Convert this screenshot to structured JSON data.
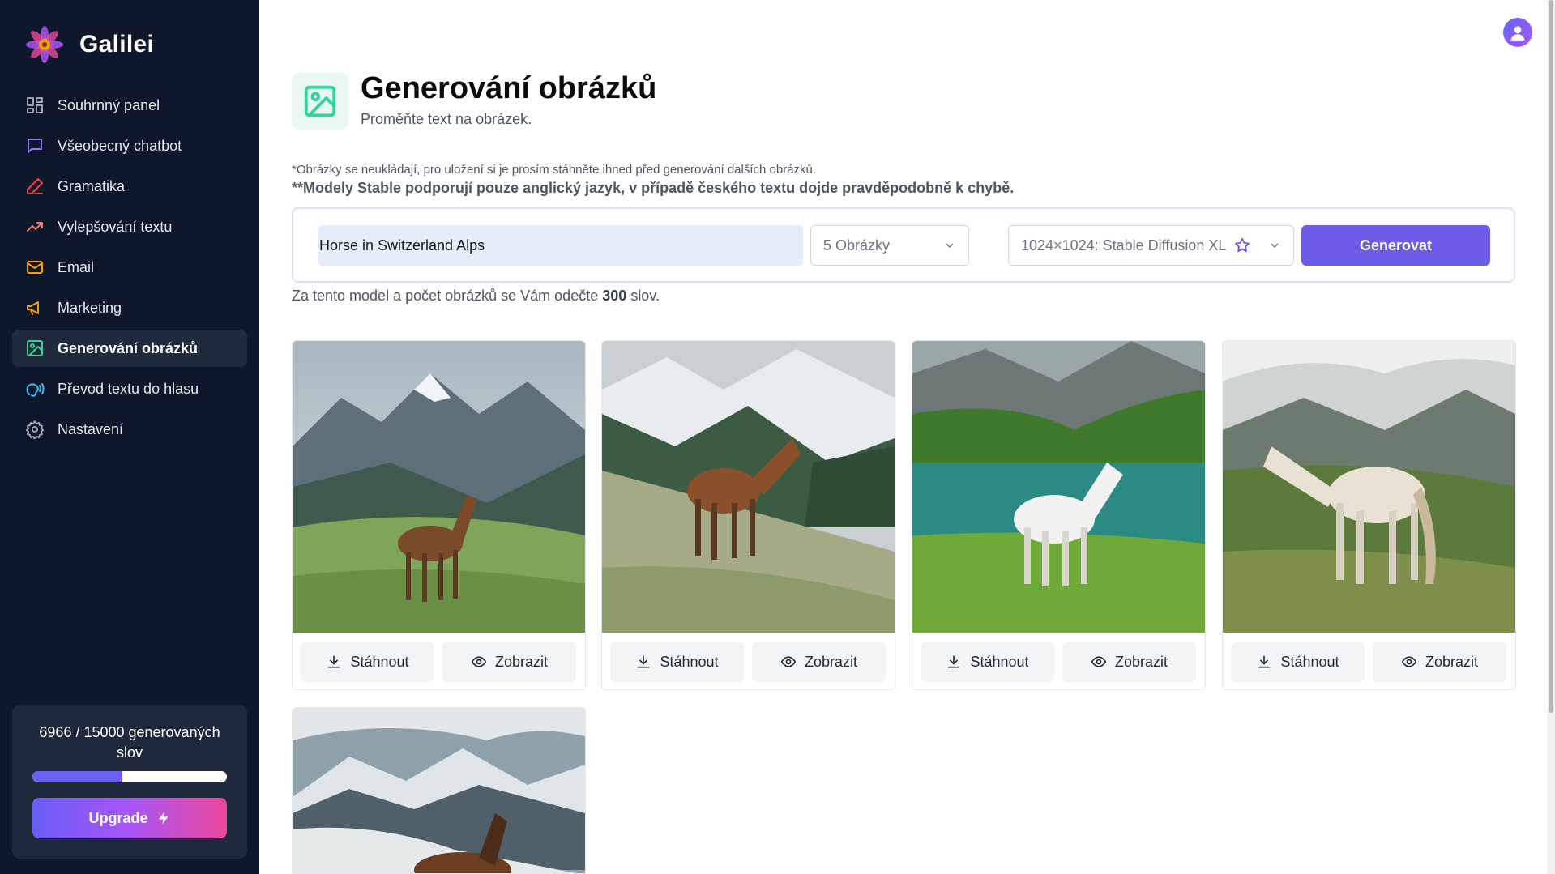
{
  "brand": {
    "name": "Galilei"
  },
  "sidebar": {
    "items": [
      {
        "label": "Souhrnný panel",
        "icon": "dashboard-icon",
        "color": "#9ca3af"
      },
      {
        "label": "Všeobecný chatbot",
        "icon": "chat-icon",
        "color": "#8b7cf6"
      },
      {
        "label": "Gramatika",
        "icon": "pen-icon",
        "color": "#ef4444"
      },
      {
        "label": "Vylepšování textu",
        "icon": "trend-up-icon",
        "color": "#f87171"
      },
      {
        "label": "Email",
        "icon": "mail-icon",
        "color": "#f59e0b"
      },
      {
        "label": "Marketing",
        "icon": "megaphone-icon",
        "color": "#f59e0b"
      },
      {
        "label": "Generování obrázků",
        "icon": "image-icon",
        "color": "#34d399",
        "active": true
      },
      {
        "label": "Převod textu do hlasu",
        "icon": "voice-icon",
        "color": "#38bdf8"
      },
      {
        "label": "Nastavení",
        "icon": "gear-icon",
        "color": "#9ca3af"
      }
    ],
    "credits": {
      "text": "6966 / 15000 generovaných slov",
      "used": 6966,
      "total": 15000,
      "upgrade_label": "Upgrade"
    }
  },
  "page": {
    "title": "Generování obrázků",
    "subtitle": "Proměňte text na obrázek.",
    "note1": "*Obrázky se neukládají, pro uložení si je prosím stáhněte ihned před generování dalších obrázků.",
    "note2": "**Modely Stable podporují pouze anglický jazyk, v případě českého textu dojde pravděpodobně k chybě."
  },
  "form": {
    "prompt_value": "Horse in Switzerland Alps",
    "count_selected": "5 Obrázky",
    "model_selected": "1024×1024: Stable Diffusion XL",
    "generate_label": "Generovat"
  },
  "cost": {
    "prefix": "Za tento model a počet obrázků se Vám odečte",
    "amount": "300",
    "suffix": "slov."
  },
  "results": {
    "download_label": "Stáhnout",
    "view_label": "Zobrazit",
    "images": [
      {
        "subject": "brown horse in alpine meadow"
      },
      {
        "subject": "brown horse on flowered slope"
      },
      {
        "subject": "white horse by alpine lake"
      },
      {
        "subject": "white horse on grassy hill"
      },
      {
        "subject": "brown horse in snowy mountains"
      }
    ]
  },
  "colors": {
    "sidebar_bg": "#0f172a",
    "accent": "#6c5ce7",
    "active_item_bg": "#1f2a3c"
  }
}
